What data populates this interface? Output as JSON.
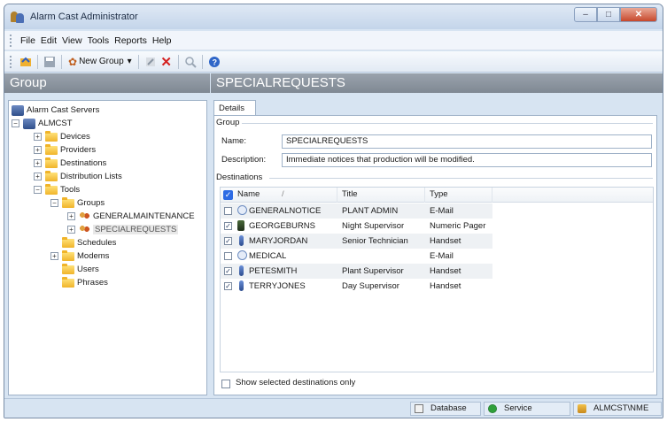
{
  "window": {
    "title": "Alarm Cast Administrator",
    "min_glyph": "–",
    "max_glyph": "□",
    "close_glyph": "✕"
  },
  "menu": [
    "File",
    "Edit",
    "View",
    "Tools",
    "Reports",
    "Help"
  ],
  "toolbar": {
    "new_group_label": "New Group",
    "dropdown_glyph": "▾"
  },
  "left_header": "Group",
  "right_header": "SPECIALREQUESTS",
  "tree": {
    "root": "Alarm Cast Servers",
    "server": "ALMCST",
    "devices": "Devices",
    "providers": "Providers",
    "destinations": "Destinations",
    "distribution_lists": "Distribution Lists",
    "tools": "Tools",
    "groups": "Groups",
    "group_1": "GENERALMAINTENANCE",
    "group_2": "SPECIALREQUESTS",
    "schedules": "Schedules",
    "modems": "Modems",
    "users": "Users",
    "phrases": "Phrases"
  },
  "tab_label": "Details",
  "group_section": {
    "label": "Group",
    "name_label": "Name:",
    "name_value": "SPECIALREQUESTS",
    "description_label": "Description:",
    "description_value": "Immediate notices that production will be modified."
  },
  "destinations_section": {
    "label": "Destinations",
    "columns": {
      "name": "Name",
      "sort_glyph": "/",
      "title": "Title",
      "type": "Type"
    },
    "rows": [
      {
        "checked": false,
        "icon": "email-icon",
        "name": "GENERALNOTICE",
        "title": "PLANT ADMIN",
        "type": "E-Mail"
      },
      {
        "checked": true,
        "icon": "pager-icon",
        "name": "GEORGEBURNS",
        "title": "Night Supervisor",
        "type": "Numeric Pager"
      },
      {
        "checked": true,
        "icon": "phone-icon",
        "name": "MARYJORDAN",
        "title": "Senior Technician",
        "type": "Handset"
      },
      {
        "checked": false,
        "icon": "email-icon",
        "name": "MEDICAL",
        "title": "",
        "type": "E-Mail"
      },
      {
        "checked": true,
        "icon": "phone-icon",
        "name": "PETESMITH",
        "title": "Plant Supervisor",
        "type": "Handset"
      },
      {
        "checked": true,
        "icon": "phone-icon",
        "name": "TERRYJONES",
        "title": "Day Supervisor",
        "type": "Handset"
      }
    ],
    "show_selected_label": "Show selected destinations only"
  },
  "status": {
    "database": "Database",
    "service": "Service",
    "user": "ALMCST\\NME"
  }
}
